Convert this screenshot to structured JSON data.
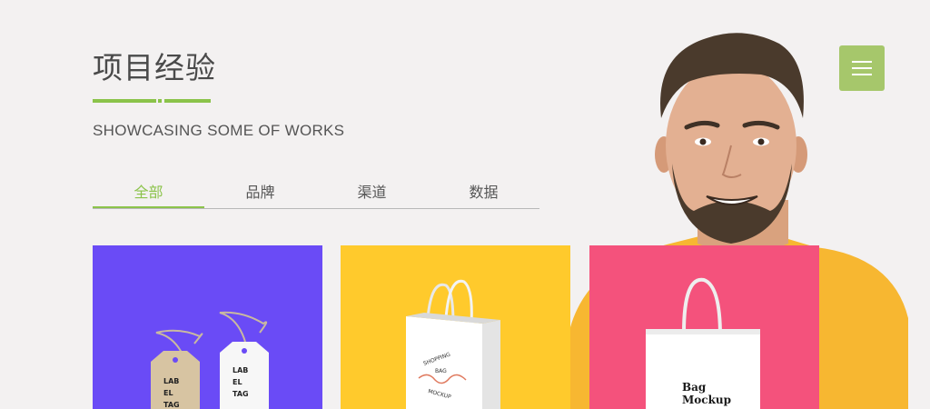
{
  "section": {
    "title": "项目经验",
    "subtitle": "SHOWCASING SOME OF WORKS"
  },
  "tabs": [
    {
      "label": "全部",
      "active": true
    },
    {
      "label": "品牌",
      "active": false
    },
    {
      "label": "渠道",
      "active": false
    },
    {
      "label": "数据",
      "active": false
    }
  ],
  "menu": {
    "icon": "hamburger-icon"
  },
  "colors": {
    "accent": "#8bc34a",
    "menu_bg": "#a6c76b",
    "card_1_bg": "#6a4bf6",
    "card_2_bg": "#ffca2c",
    "card_3_bg": "#f4527c",
    "sweater": "#f7b731"
  },
  "cards": [
    {
      "mockup": "label-tags",
      "tag_text": [
        "LAB",
        "EL",
        "TAG"
      ],
      "tag2_text": [
        "LAB",
        "EL",
        "TAG"
      ]
    },
    {
      "mockup": "shopping-bag",
      "bag_text": [
        "SHOPPING",
        "BAG",
        "MOCKUP"
      ]
    },
    {
      "mockup": "bag-mockup",
      "bag_title": [
        "Bag",
        "Mockup"
      ]
    }
  ]
}
